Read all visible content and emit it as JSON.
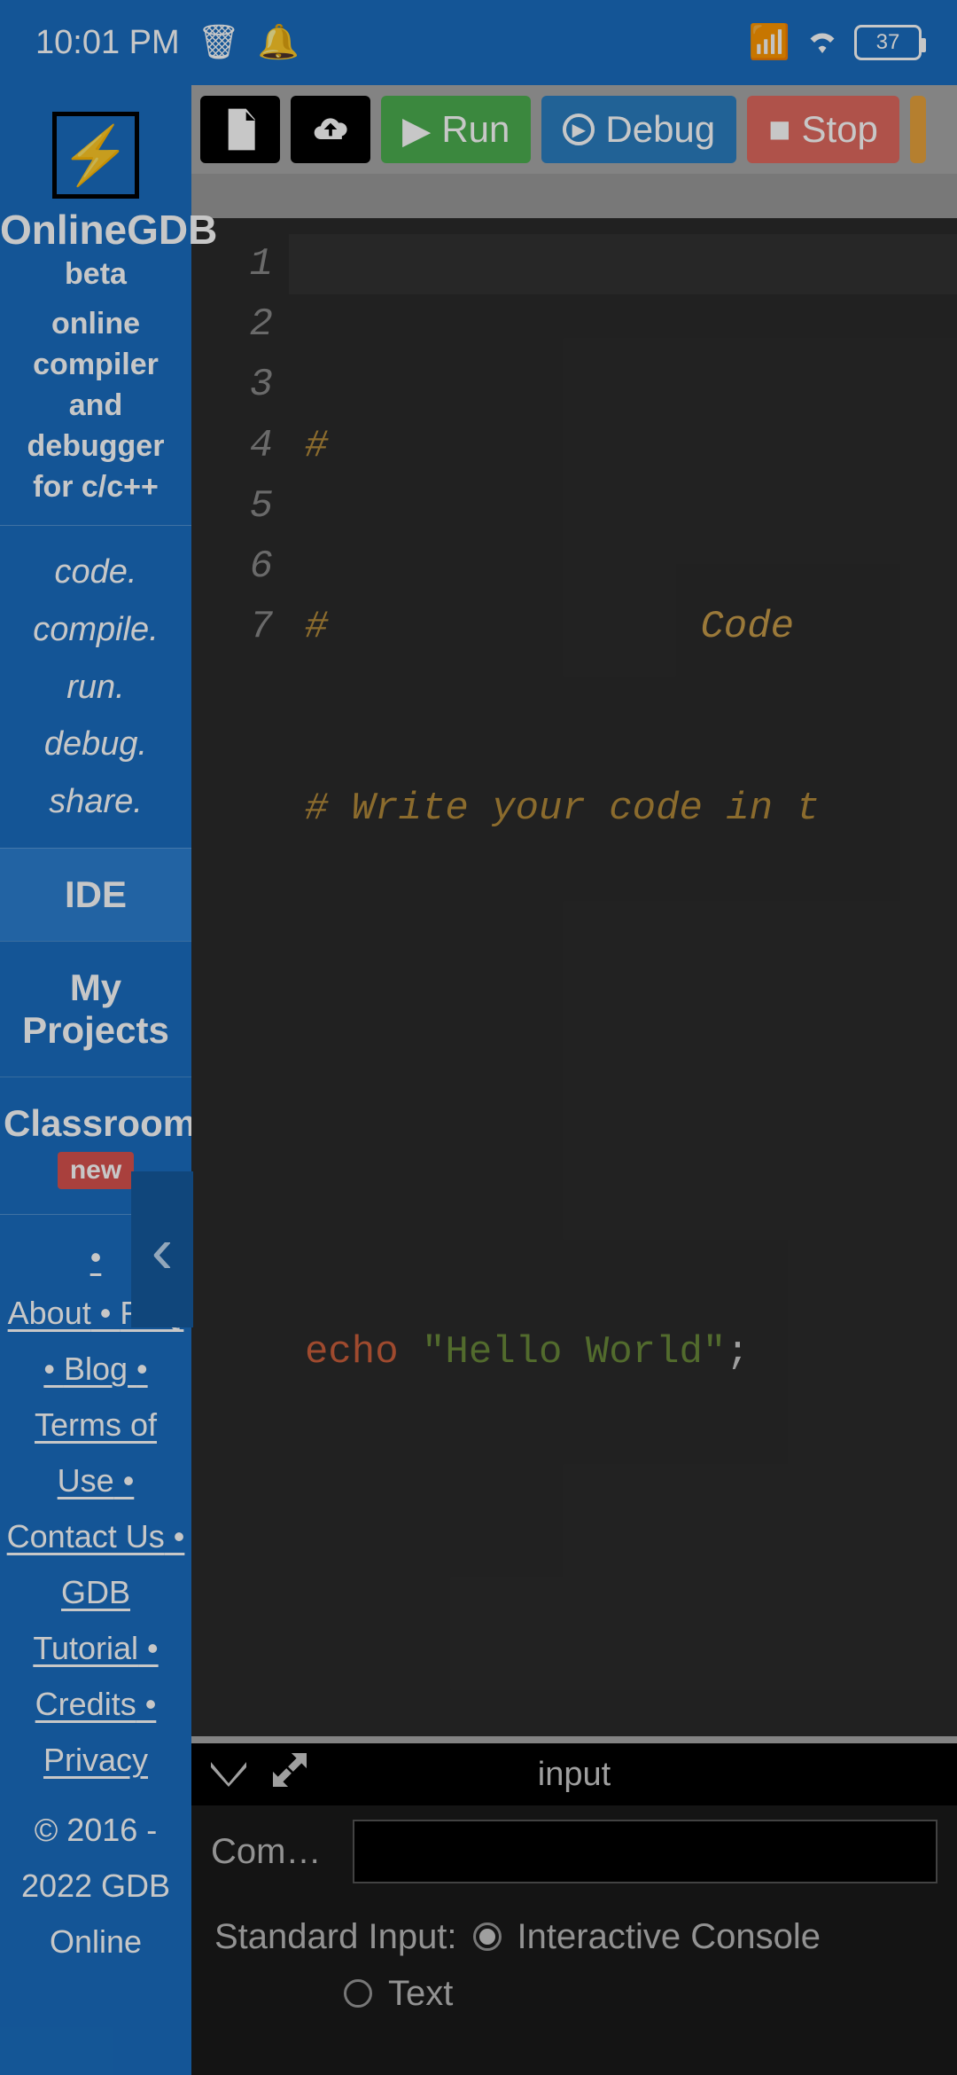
{
  "status": {
    "time": "10:01 PM",
    "battery": "37"
  },
  "sidebar": {
    "brand": "OnlineGDB",
    "beta": "beta",
    "tagline": "online compiler and debugger for c/c++",
    "slogan1": "code.",
    "slogan2": "compile.",
    "slogan3": "run.",
    "slogan4": "debug.",
    "slogan5": "share.",
    "nav_ide": "IDE",
    "nav_projects": "My Projects",
    "nav_classroom": "Classroom",
    "badge_new": "new",
    "link_about": "About",
    "link_faq": "FAQ",
    "link_blog": "Blog",
    "link_terms": "Terms of Use",
    "link_contact": "Contact Us",
    "link_tutorial": "GDB Tutorial",
    "link_credits": "Credits",
    "link_privacy": "Privacy",
    "copyright": "© 2016 - 2022 GDB Online"
  },
  "toolbar": {
    "run": "Run",
    "debug": "Debug",
    "stop": "Stop"
  },
  "editor": {
    "lines": {
      "l1": "#",
      "l2_a": "#",
      "l2_b": "Code",
      "l3": "# Write your code in t",
      "l6_kw": "echo",
      "l6_str": "\"Hello World\"",
      "l6_semi": ";"
    },
    "linenums": {
      "n1": "1",
      "n2": "2",
      "n3": "3",
      "n4": "4",
      "n5": "5",
      "n6": "6",
      "n7": "7"
    }
  },
  "console": {
    "title": "input",
    "cmd_label": "Com…",
    "stdin_label": "Standard Input:",
    "opt_interactive": "Interactive Console",
    "opt_text": "Text"
  }
}
